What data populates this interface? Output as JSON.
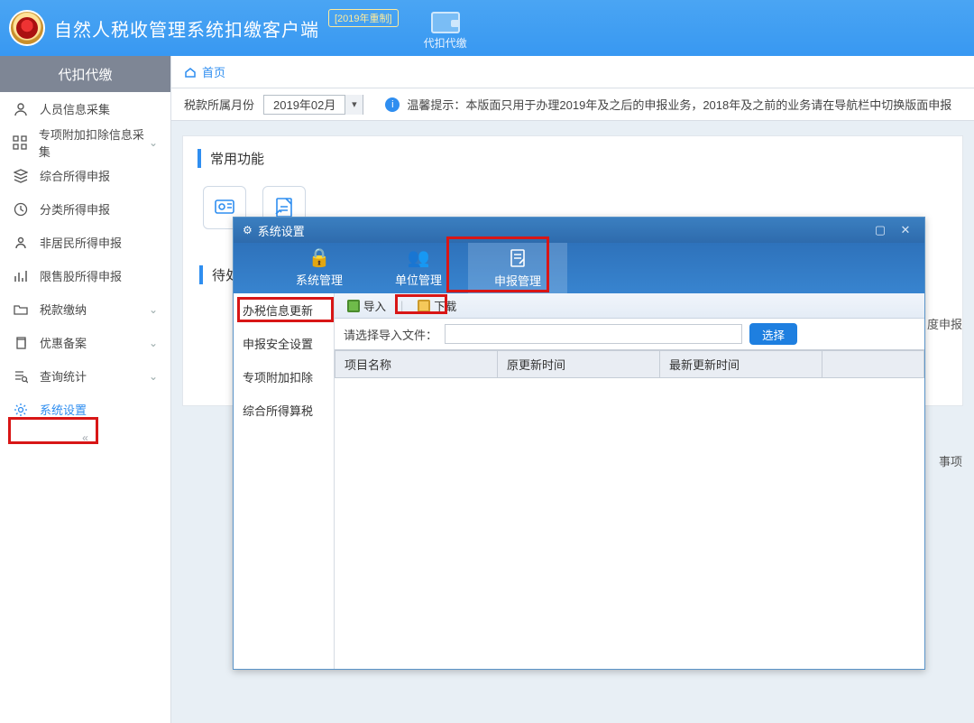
{
  "header": {
    "app_title": "自然人税收管理系统扣缴客户端",
    "version_badge": "[2019年重制]",
    "wallet_label": "代扣代缴"
  },
  "sidebar": {
    "header": "代扣代缴",
    "items": [
      {
        "label": "人员信息采集",
        "expandable": false
      },
      {
        "label": "专项附加扣除信息采集",
        "expandable": true
      },
      {
        "label": "综合所得申报",
        "expandable": false
      },
      {
        "label": "分类所得申报",
        "expandable": false
      },
      {
        "label": "非居民所得申报",
        "expandable": false
      },
      {
        "label": "限售股所得申报",
        "expandable": false
      },
      {
        "label": "税款缴纳",
        "expandable": true
      },
      {
        "label": "优惠备案",
        "expandable": true
      },
      {
        "label": "查询统计",
        "expandable": true
      },
      {
        "label": "系统设置",
        "expandable": false,
        "active": true
      }
    ]
  },
  "breadcrumb": {
    "home": "首页"
  },
  "period_bar": {
    "label": "税款所属月份",
    "value": "2019年02月",
    "tip": "温馨提示：本版面只用于办理2019年及之后的申报业务，2018年及之前的业务请在导航栏中切换版面申报"
  },
  "content": {
    "section1_title": "常用功能",
    "section2_title": "待处",
    "side_text1": "月度申报",
    "side_text2": "事项"
  },
  "dialog": {
    "title": "系统设置",
    "tabs": [
      {
        "label": "系统管理"
      },
      {
        "label": "单位管理"
      },
      {
        "label": "申报管理",
        "active": true
      }
    ],
    "leftnav": [
      "办税信息更新",
      "申报安全设置",
      "专项附加扣除",
      "综合所得算税"
    ],
    "toolbar": {
      "import_label": "导入",
      "download_label": "下载"
    },
    "filerow": {
      "label": "请选择导入文件：",
      "choose_btn": "选择"
    },
    "table": {
      "columns": [
        "项目名称",
        "原更新时间",
        "最新更新时间"
      ]
    }
  }
}
